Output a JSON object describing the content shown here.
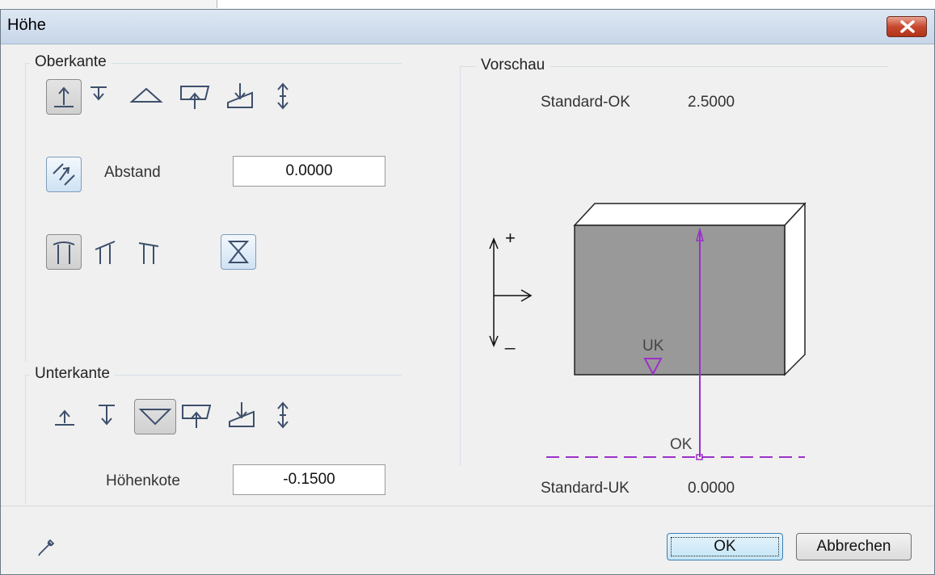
{
  "dialog": {
    "title": "Höhe"
  },
  "top": {
    "legend": "Oberkante",
    "abstand_label": "Abstand",
    "abstand_value": "0.0000"
  },
  "bottom": {
    "legend": "Unterkante",
    "hoehenkote_label": "Höhenkote",
    "hoehenkote_value": "-0.1500"
  },
  "preview": {
    "legend": "Vorschau",
    "standard_ok_label": "Standard-OK",
    "standard_ok_value": "2.5000",
    "standard_uk_label": "Standard-UK",
    "standard_uk_value": "0.0000",
    "uk_marker": "UK",
    "ok_marker": "OK",
    "plus_sign": "+",
    "minus_sign": "_",
    "colors": {
      "box_face": "#999999",
      "marker": "#9b30c8"
    }
  },
  "footer": {
    "ok_label": "OK",
    "cancel_label": "Abbrechen"
  }
}
